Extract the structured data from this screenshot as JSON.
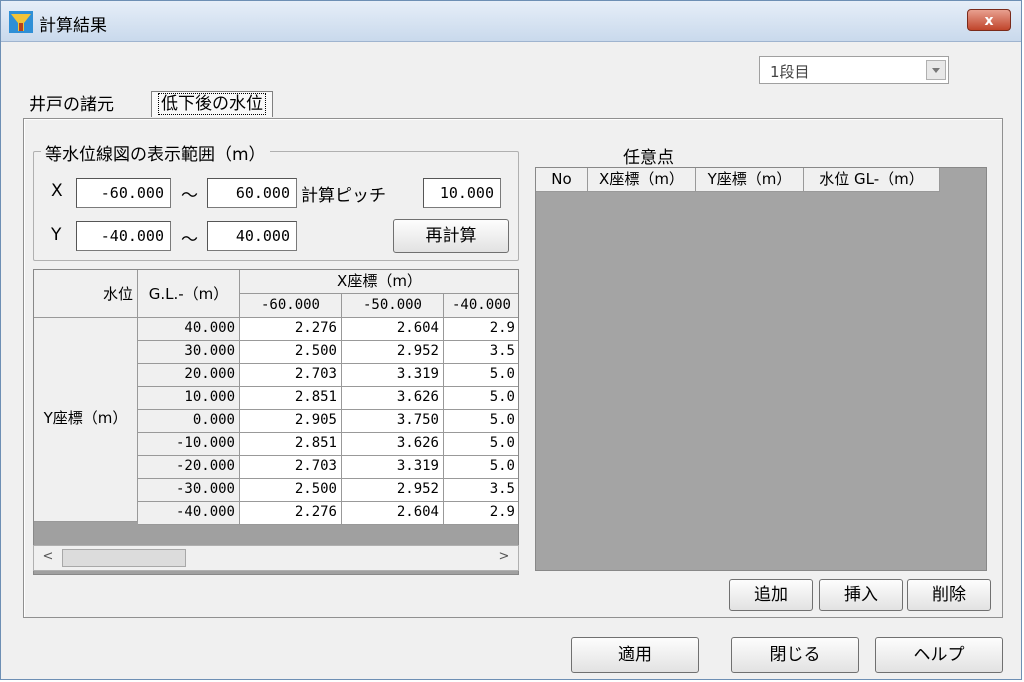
{
  "window": {
    "title": "計算結果",
    "close_label": "x"
  },
  "stage_select": {
    "value": "1段目"
  },
  "tabs": [
    {
      "label": "井戸の諸元"
    },
    {
      "label": "低下後の水位"
    }
  ],
  "range_group": {
    "title": "等水位線図の表示範囲（m）",
    "x_label": "X",
    "x_from": "-60.000",
    "x_to": "60.000",
    "pitch_label": "計算ピッチ",
    "pitch": "10.000",
    "y_label": "Y",
    "y_from": "-40.000",
    "y_to": "40.000",
    "tilde": "～",
    "recalc_label": "再計算"
  },
  "grid": {
    "corner_label": "水位",
    "gl_label": "G.L.-（m）",
    "x_header": "X座標（m）",
    "y_header": "Y座標（m）",
    "x_values": [
      "-60.000",
      "-50.000",
      "-40.000"
    ],
    "rows": [
      {
        "y": "40.000",
        "cells": [
          "2.276",
          "2.604",
          "2.9"
        ]
      },
      {
        "y": "30.000",
        "cells": [
          "2.500",
          "2.952",
          "3.5"
        ]
      },
      {
        "y": "20.000",
        "cells": [
          "2.703",
          "3.319",
          "5.0"
        ]
      },
      {
        "y": "10.000",
        "cells": [
          "2.851",
          "3.626",
          "5.0"
        ]
      },
      {
        "y": "0.000",
        "cells": [
          "2.905",
          "3.750",
          "5.0"
        ]
      },
      {
        "y": "-10.000",
        "cells": [
          "2.851",
          "3.626",
          "5.0"
        ]
      },
      {
        "y": "-20.000",
        "cells": [
          "2.703",
          "3.319",
          "5.0"
        ]
      },
      {
        "y": "-30.000",
        "cells": [
          "2.500",
          "2.952",
          "3.5"
        ]
      },
      {
        "y": "-40.000",
        "cells": [
          "2.276",
          "2.604",
          "2.9"
        ]
      }
    ]
  },
  "points": {
    "title": "任意点",
    "columns": [
      "No",
      "X座標（m）",
      "Y座標（m）",
      "水位 GL-（m）"
    ],
    "add_label": "追加",
    "insert_label": "挿入",
    "delete_label": "削除"
  },
  "footer": {
    "apply_label": "適用",
    "close_label": "閉じる",
    "help_label": "ヘルプ"
  }
}
